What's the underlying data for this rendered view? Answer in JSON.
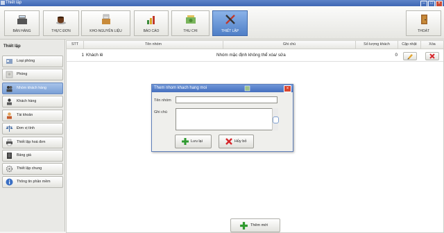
{
  "window": {
    "title": "Thiết lập"
  },
  "toolbar": {
    "items": [
      {
        "label": "BÁN HÀNG"
      },
      {
        "label": "THỰC ĐƠN"
      },
      {
        "label": "KHO-NGUYÊN LIỆU"
      },
      {
        "label": "BÁO CÁO"
      },
      {
        "label": "THU CHI"
      },
      {
        "label": "THIẾT LẬP"
      }
    ],
    "exit_label": "THOÁT"
  },
  "sidebar": {
    "title": "Thiết lập",
    "items": [
      {
        "label": "Loại phòng"
      },
      {
        "label": "Phòng"
      },
      {
        "label": "Nhóm khách hàng"
      },
      {
        "label": "Khách hàng"
      },
      {
        "label": "Tài khoản"
      },
      {
        "label": "Đơn vị tính"
      },
      {
        "label": "Thiết lập hoá đơn"
      },
      {
        "label": "Bảng giá"
      },
      {
        "label": "Thiết lập chung"
      },
      {
        "label": "Thông tin phần mềm"
      }
    ]
  },
  "table": {
    "columns": [
      "STT",
      "Tên nhóm",
      "Ghi chú",
      "Số lượng khách",
      "Cập nhật",
      "Xóa"
    ],
    "rows": [
      {
        "stt": "1",
        "name": "Khách lẻ",
        "note": "Nhóm mặc định không thể xóa/ sửa",
        "count": "0"
      }
    ]
  },
  "dialog": {
    "title": "Them nhom khach hang moi",
    "name_label": "Tên nhóm",
    "name_value": "",
    "note_label": "Ghi chú",
    "note_value": "",
    "save_label": "Lưu lại",
    "cancel_label": "Hủy bỏ"
  },
  "add_button": {
    "label": "Thêm mới"
  },
  "colors": {
    "accent": "#4f7fc7",
    "titlebar": "#3e67b4",
    "close": "#d8452e",
    "add_green": "#2f9a2f"
  }
}
